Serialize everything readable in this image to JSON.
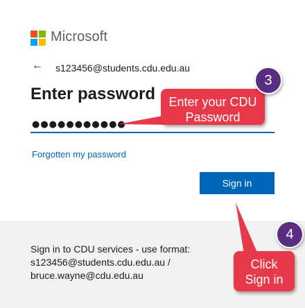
{
  "brand": {
    "name": "Microsoft"
  },
  "identity": {
    "back_icon": "←",
    "email": "s123456@students.cdu.edu.au"
  },
  "page": {
    "title": "Enter password"
  },
  "password": {
    "masked_value": "●●●●●●●●●●●"
  },
  "links": {
    "forgot": "Forgotten my password"
  },
  "actions": {
    "signin_label": "Sign in"
  },
  "footer": {
    "lines": [
      "Sign in to CDU services - use format:",
      "s123456@students.cdu.edu.au /",
      "bruce.wayne@cdu.edu.au"
    ]
  },
  "annotations": {
    "step3": {
      "number": "3",
      "text_line1": "Enter your CDU",
      "text_line2": "Password"
    },
    "step4": {
      "number": "4",
      "text_line1": "Click",
      "text_line2": "Sign in"
    }
  },
  "colors": {
    "accent_blue": "#0067b8",
    "callout_red": "#e8394a",
    "badge_purple": "#5a2d82",
    "footer_bg": "#f2f2f2"
  }
}
